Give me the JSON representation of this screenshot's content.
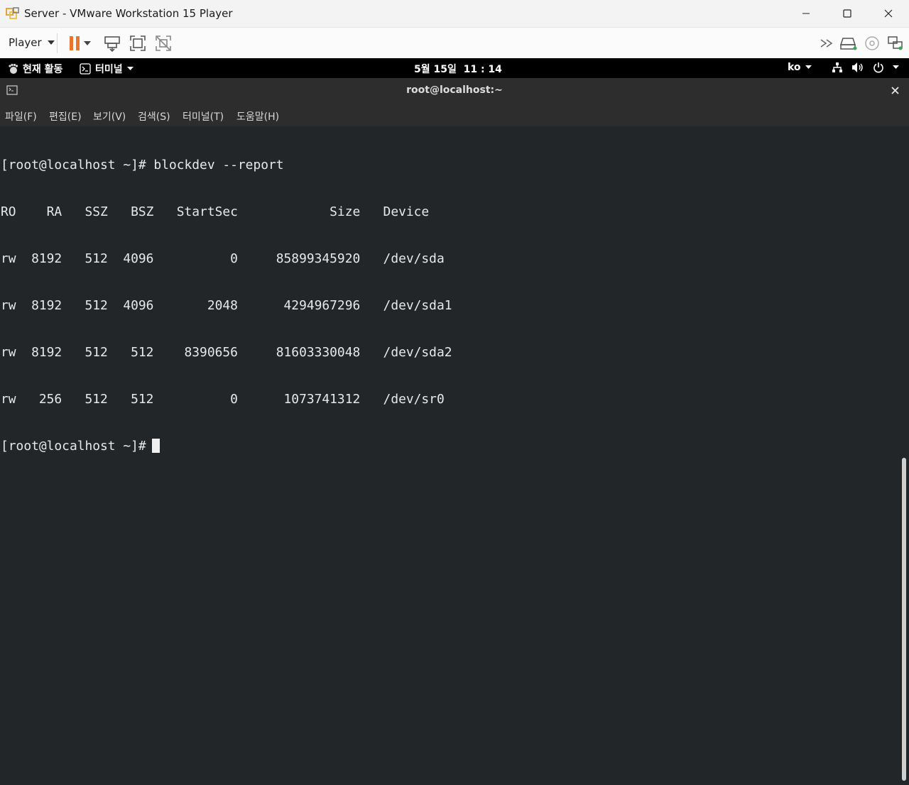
{
  "window": {
    "title": "Server - VMware Workstation 15 Player",
    "controls": [
      "minimize",
      "maximize",
      "close"
    ]
  },
  "toolbar": {
    "player_label": "Player",
    "pause_color": "#e8762c",
    "icons": [
      "pause-icon",
      "send-ctrl-alt-del-icon",
      "fullscreen-icon",
      "unity-icon"
    ],
    "right_icons": [
      "chevron-right-double-icon",
      "hard-disk-icon",
      "cd-icon",
      "network-icon"
    ]
  },
  "gnome": {
    "activities": "현재 활동",
    "app_menu": "터미널",
    "clock": "5월 15일  11 : 14",
    "input_method": "ko"
  },
  "terminal": {
    "title": "root@localhost:~",
    "menu": [
      "파일(F)",
      "편집(E)",
      "보기(V)",
      "검색(S)",
      "터미널(T)",
      "도움말(H)"
    ],
    "lines": [
      "[root@localhost ~]# blockdev --report",
      "RO    RA   SSZ   BSZ   StartSec            Size   Device",
      "rw  8192   512  4096          0     85899345920   /dev/sda",
      "rw  8192   512  4096       2048      4294967296   /dev/sda1",
      "rw  8192   512   512    8390656     81603330048   /dev/sda2",
      "rw   256   512   512          0      1073741312   /dev/sr0"
    ],
    "prompt": "[root@localhost ~]#",
    "colors": {
      "background": "#232628",
      "foreground": "#e8e8e8"
    }
  }
}
